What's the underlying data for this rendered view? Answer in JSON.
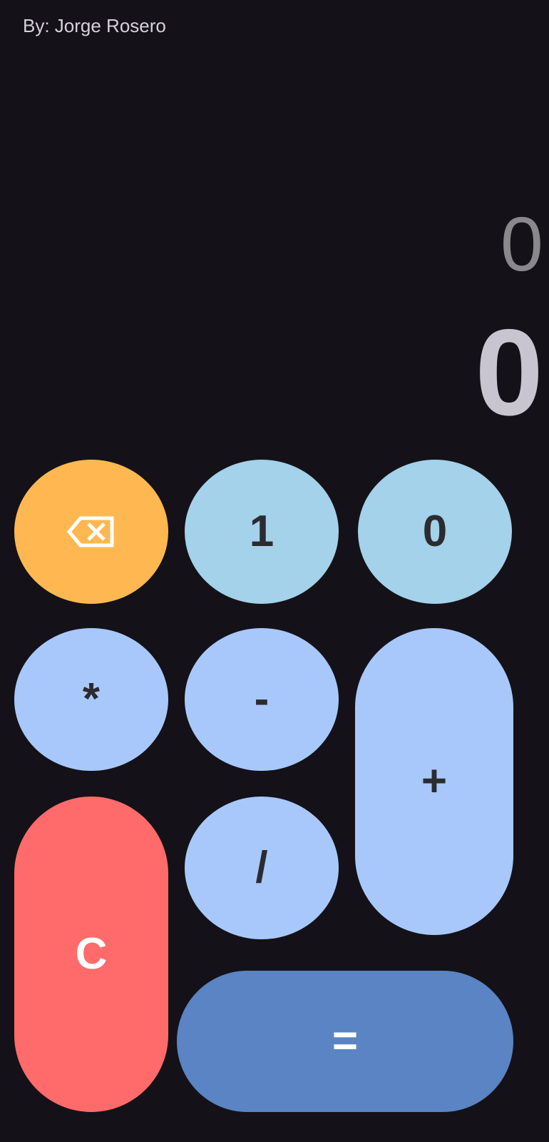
{
  "header": {
    "author": "By: Jorge Rosero"
  },
  "display": {
    "expression": "0",
    "result": "0"
  },
  "buttons": {
    "backspace_icon": "backspace-icon",
    "one": "1",
    "zero": "0",
    "multiply": "*",
    "subtract": "-",
    "add": "+",
    "divide": "/",
    "clear": "C",
    "equals": "="
  },
  "colors": {
    "background": "#141218",
    "backspace": "#ffb851",
    "digit": "#a3d2ea",
    "operator": "#a8c8fb",
    "clear": "#ff6b6b",
    "equals": "#5a84c3"
  }
}
